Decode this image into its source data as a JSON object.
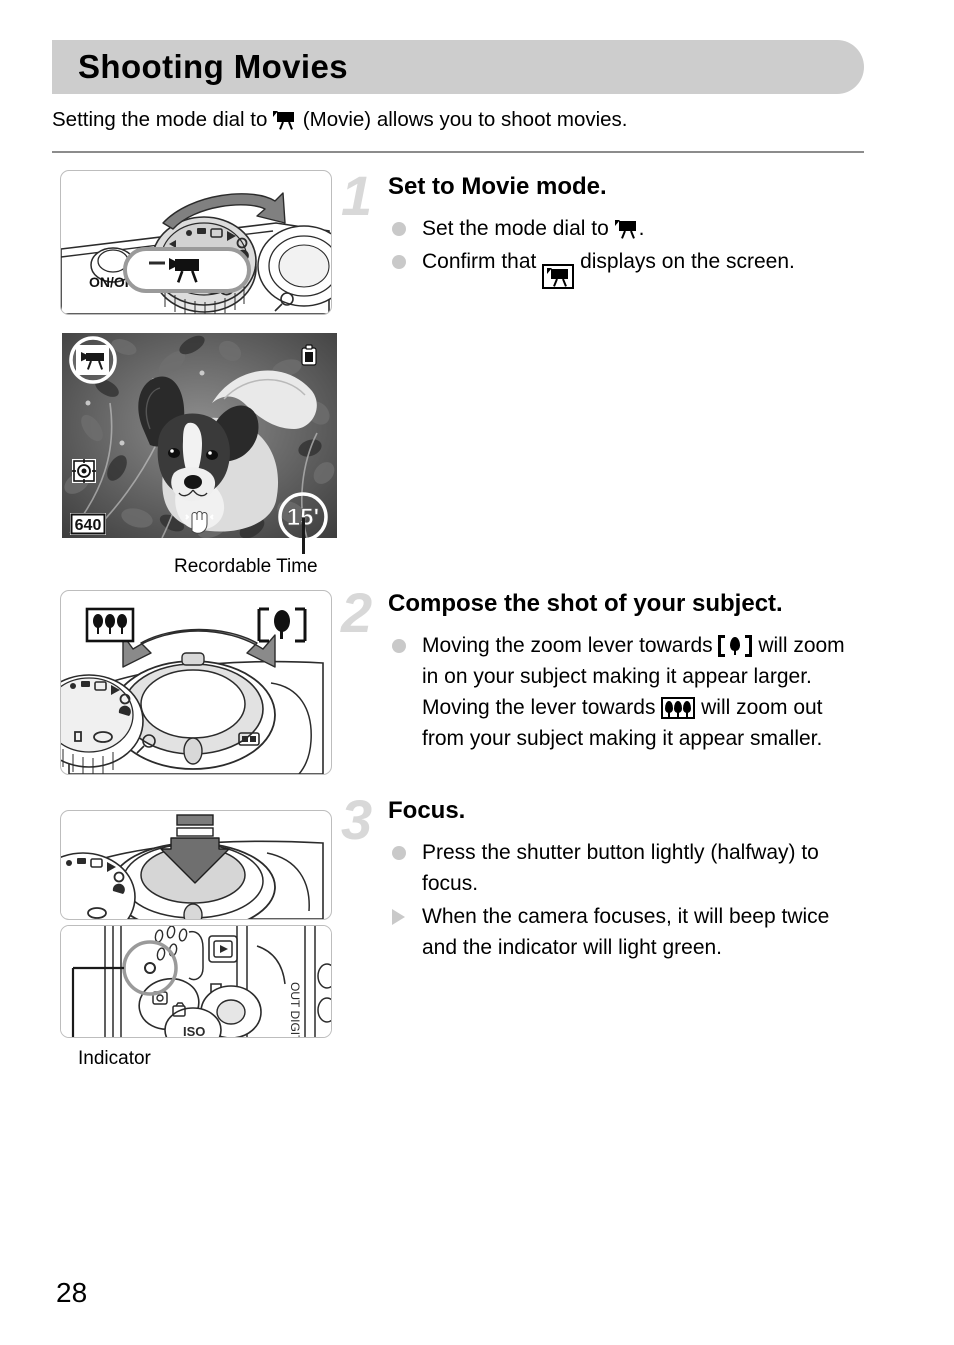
{
  "page": {
    "title": "Shooting Movies",
    "intro_before": "Setting the mode dial to",
    "intro_after": "(Movie) allows you to shoot movies.",
    "page_number": "28"
  },
  "steps": [
    {
      "number": "1",
      "title": "Set to Movie mode.",
      "bullets": [
        {
          "marker": "dot",
          "before": "Set the mode dial to",
          "icon": "movie-icon",
          "after": "."
        },
        {
          "marker": "dot",
          "before": "Confirm that",
          "icon": "movie-boxed-icon",
          "after": "displays on the screen."
        }
      ]
    },
    {
      "number": "2",
      "title": "Compose the shot of your subject.",
      "bullets": [
        {
          "marker": "dot",
          "seg1": "Moving the zoom lever towards",
          "icon1": "telephoto-icon",
          "seg2": "will zoom in on your subject making it appear larger. Moving the lever towards",
          "icon2": "wide-angle-icon",
          "seg3": "will zoom out from your subject making it appear smaller."
        }
      ]
    },
    {
      "number": "3",
      "title": "Focus.",
      "bullets": [
        {
          "marker": "dot",
          "text": "Press the shutter button lightly (halfway) to focus."
        },
        {
          "marker": "triangle",
          "text": "When the camera focuses, it will beep twice and the indicator will light green."
        }
      ]
    }
  ],
  "figures": {
    "mode_dial": {
      "name": "mode-dial-illustration",
      "on_off_label": "ON/OFF"
    },
    "lcd_screen": {
      "name": "lcd-preview",
      "resolution_indicator": "640",
      "recordable_time": "15'",
      "caption": "Recordable Time"
    },
    "zoom_lever": {
      "name": "zoom-lever-illustration"
    },
    "shutter_button": {
      "name": "shutter-button-illustration"
    },
    "indicator": {
      "name": "indicator-illustration",
      "side_text": "OUT DIGITAL",
      "caption": "Indicator"
    }
  },
  "colors": {
    "header_bar": "#cdcdcd",
    "rule": "#8c8c8c",
    "step_number": "#d8d8d8",
    "bullet_marker": "#c9c9c9",
    "figure_border": "#bdbdbd"
  }
}
